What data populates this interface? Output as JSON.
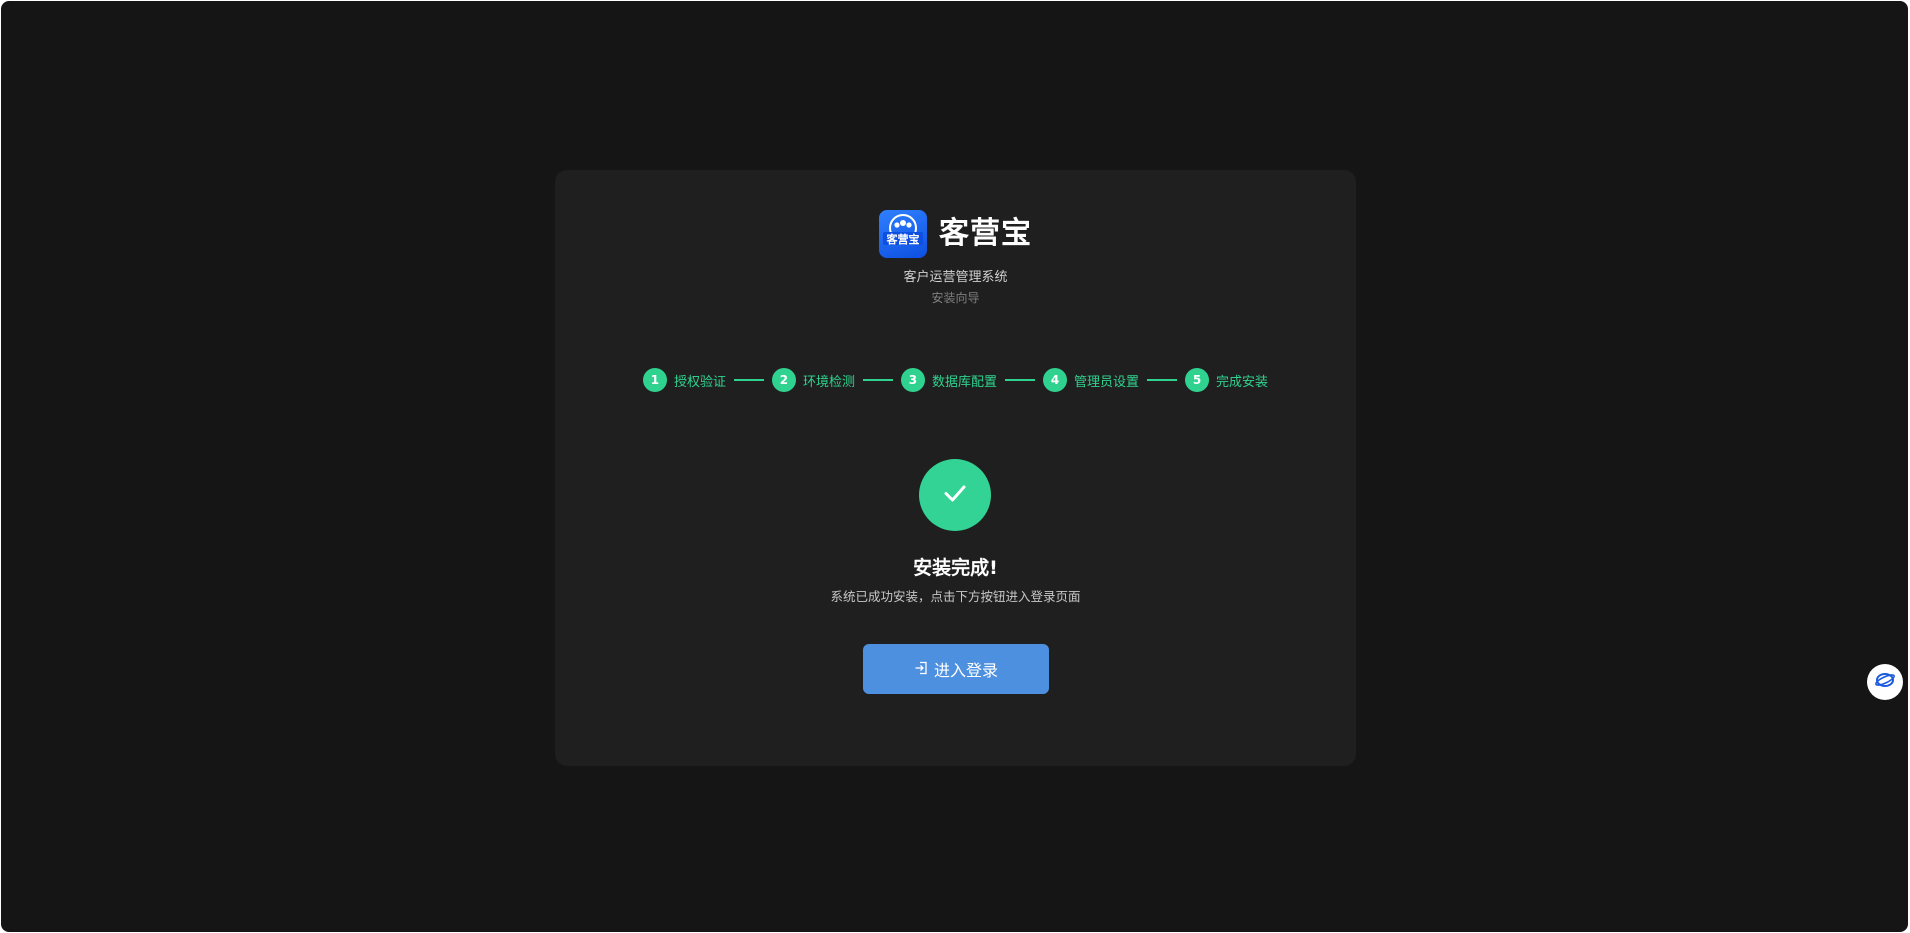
{
  "brand": {
    "logo_text": "客营宝",
    "name": "客营宝",
    "subtitle": "客户运营管理系统",
    "tagline": "安装向导"
  },
  "steps": [
    {
      "num": "1",
      "label": "授权验证"
    },
    {
      "num": "2",
      "label": "环境检测"
    },
    {
      "num": "3",
      "label": "数据库配置"
    },
    {
      "num": "4",
      "label": "管理员设置"
    },
    {
      "num": "5",
      "label": "完成安装"
    }
  ],
  "result": {
    "icon": "check-icon",
    "title": "安装完成!",
    "description": "系统已成功安装，点击下方按钮进入登录页面"
  },
  "actions": {
    "login_icon": "login-icon",
    "login_label": "进入登录"
  },
  "colors": {
    "background": "#151515",
    "card": "#1f1f1f",
    "accent_green": "#2fd38f",
    "button_blue": "#4d90e0"
  }
}
